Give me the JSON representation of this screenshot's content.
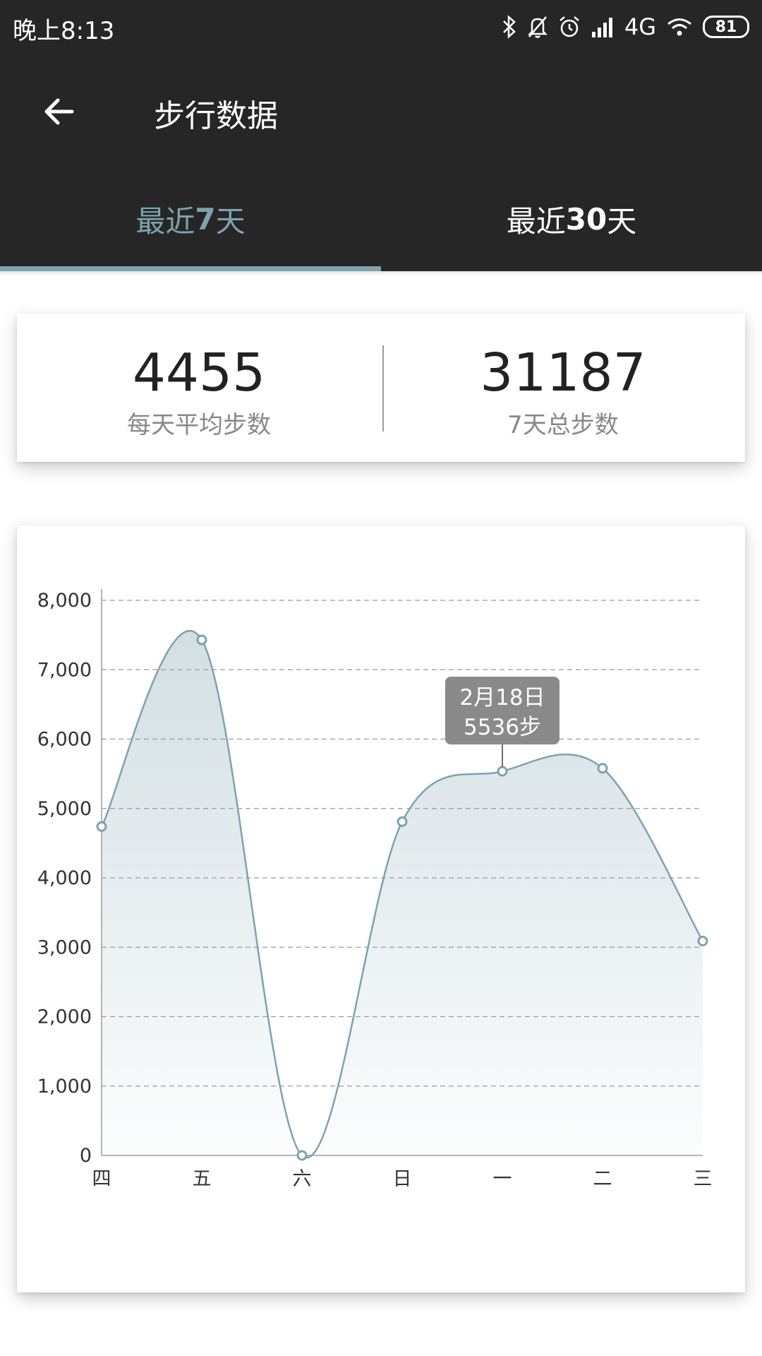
{
  "status_bar": {
    "time": "晚上8:13",
    "network": "4G",
    "battery": "81",
    "icons": [
      "bluetooth-icon",
      "bell-off-icon",
      "alarm-icon",
      "signal-icon",
      "wifi-icon",
      "battery-icon"
    ]
  },
  "app_bar": {
    "title": "步行数据",
    "back_icon": "arrow-left-icon"
  },
  "tabs": [
    {
      "prefix": "最近",
      "num": "7",
      "suffix": "天",
      "active": true
    },
    {
      "prefix": "最近",
      "num": "30",
      "suffix": "天",
      "active": false
    }
  ],
  "summary": {
    "avg_value": "4455",
    "avg_label": "每天平均步数",
    "total_value": "31187",
    "total_label": "7天总步数"
  },
  "colors": {
    "accent": "#7fa2ae",
    "appbar": "#262626",
    "tooltip": "#8a8a8a"
  },
  "tooltip": {
    "date": "2月18日",
    "steps": "5536步",
    "index": 4
  },
  "chart_data": {
    "type": "area",
    "categories": [
      "四",
      "五",
      "六",
      "日",
      "一",
      "二",
      "三"
    ],
    "values": [
      4740,
      7430,
      0,
      4810,
      5536,
      5580,
      3090
    ],
    "y_ticks": [
      "0",
      "1,000",
      "2,000",
      "3,000",
      "4,000",
      "5,000",
      "6,000",
      "7,000",
      "8,000"
    ],
    "ylim": [
      0,
      8000
    ],
    "grid": "dashed-horizontal",
    "smooth": true,
    "title": "",
    "xlabel": "",
    "ylabel": ""
  }
}
